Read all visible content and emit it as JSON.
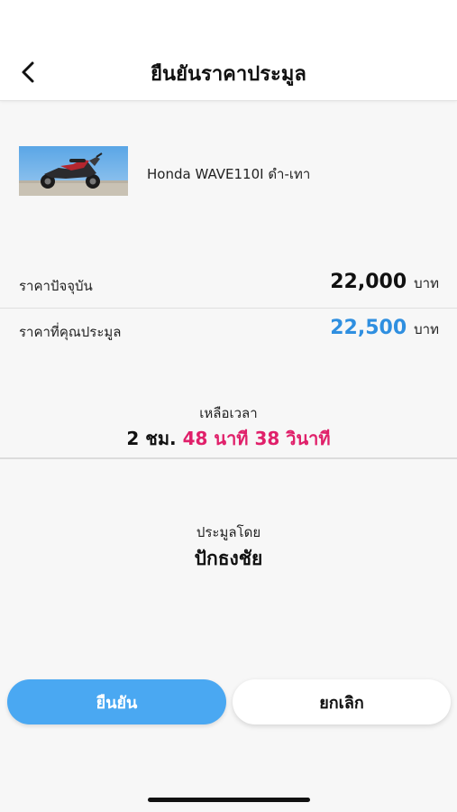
{
  "header": {
    "title": "ยืนยันราคาประมูล",
    "back_icon": "chevron-left-icon"
  },
  "product": {
    "name": "Honda WAVE110I ดำ-เทา",
    "image": "motorcycle-photo"
  },
  "prices": {
    "current_label": "ราคาปัจจุบัน",
    "current_value": "22,000",
    "bid_label": "ราคาที่คุณประมูล",
    "bid_value": "22,500",
    "unit": "บาท"
  },
  "timer": {
    "label": "เหลือเวลา",
    "hours": "2 ชม.",
    "minutes": "48 นาที",
    "seconds": "38 วินาที"
  },
  "bidder": {
    "label": "ประมูลโดย",
    "name": "ปักธงชัย"
  },
  "actions": {
    "confirm_label": "ยืนยัน",
    "cancel_label": "ยกเลิก"
  },
  "colors": {
    "accent_blue": "#4aa8f2",
    "bid_price_blue": "#2f8fe0",
    "countdown_pink": "#e0206a"
  }
}
